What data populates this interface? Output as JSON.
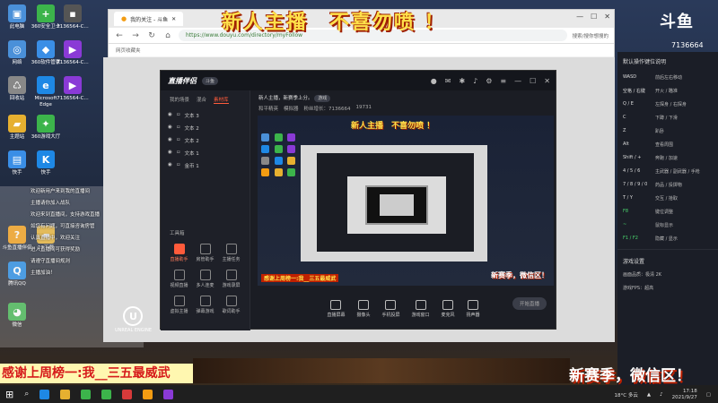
{
  "overlay": {
    "top_banner": "新人主播　不喜勿喷 ！",
    "bottom_left_banner": "感谢上周榜一:我__三五最威武",
    "bottom_right_banner": "新赛季，微信区！",
    "brand": "斗鱼",
    "room_id": "7136664"
  },
  "desktop_icons": [
    {
      "label": "此电脑",
      "icon": "computer-icon",
      "color": "#4a90d9"
    },
    {
      "label": "360安全卫士",
      "icon": "shield-icon",
      "color": "#3cb44b"
    },
    {
      "label": "7136564-C...",
      "icon": "file-icon",
      "color": "#666"
    },
    {
      "label": "网络",
      "icon": "network-icon",
      "color": "#4a90d9"
    },
    {
      "label": "360软件管家",
      "icon": "store-icon",
      "color": "#3a8ee6"
    },
    {
      "label": "7136564-C...",
      "icon": "video-icon",
      "color": "#8a3ad6"
    },
    {
      "label": "回收站",
      "icon": "trash-icon",
      "color": "#888"
    },
    {
      "label": "Microsoft Edge",
      "icon": "edge-icon",
      "color": "#1e88e5"
    },
    {
      "label": "7136564-C...",
      "icon": "video-icon",
      "color": "#8a3ad6"
    },
    {
      "label": "主题站",
      "icon": "folder-icon",
      "color": "#e6b030"
    },
    {
      "label": "360游戏大厅",
      "icon": "game-icon",
      "color": "#3cb44b"
    },
    {
      "label": "快手",
      "icon": "kuaishou-icon",
      "color": "#1e88e5"
    },
    {
      "label": "13下载",
      "icon": "download-icon",
      "color": "#d63a3a"
    },
    {
      "label": "斗鱼直播伴侣",
      "icon": "douyu-icon",
      "color": "#f39c12"
    },
    {
      "label": "腾讯QQ",
      "icon": "qq-icon",
      "color": "#1e88e5"
    },
    {
      "label": "微信",
      "icon": "wechat-icon",
      "color": "#3cb44b"
    }
  ],
  "browser": {
    "tab_title": "我的关注 - 斗鱼",
    "url": "https://www.douyu.com/directory/myFollow",
    "bookmarks": "网页收藏夹",
    "right_controls": "搜索/搜你想搜的"
  },
  "app": {
    "logo": "直播伴侣",
    "version_badge": "斗鱼",
    "left_tabs": [
      "我的场景",
      "混合",
      "素材库"
    ],
    "scenes": [
      "文本 3",
      "文本 2",
      "文本 2",
      "文本 1",
      "金币 1"
    ],
    "tools_title": "工具箱",
    "tools": [
      "直播助手",
      "房管助手",
      "主播任务",
      "视频直播",
      "多人连麦",
      "游戏录屏",
      "虚拟主播",
      "弹幕游戏",
      "歌词助手",
      "主播专区"
    ],
    "title_line": "新人主播，新赛季上分。",
    "title_tag": "游戏",
    "stream_info": [
      "和平精英",
      "模拟器",
      "粉丝增长：7136664",
      "19731"
    ],
    "bottom_tools": [
      "直播屏幕",
      "摄像头",
      "手机投屏",
      "游戏窗口",
      "麦克风",
      "扬声器"
    ],
    "start_button": "开始直播",
    "preview_top": "新人主播　不喜勿喷 ！",
    "preview_bottom_left": "感谢上周榜一:我__三五最威武",
    "preview_bottom_right": "新赛季，微信区！"
  },
  "help_panel": {
    "title": "默认操作键位说明",
    "rows": [
      {
        "key": "WASD",
        "desc": "前后左右移动"
      },
      {
        "key": "空格 / 右键",
        "desc": "开火 / 瞄准"
      },
      {
        "key": "Q / E",
        "desc": "左探身 / 右探身"
      },
      {
        "key": "C",
        "desc": "下蹲 / 下滑"
      },
      {
        "key": "Z",
        "desc": "趴卧"
      },
      {
        "key": "Alt",
        "desc": "查看周围"
      },
      {
        "key": "Shift / +",
        "desc": "奔跑 / 加速"
      },
      {
        "key": "4 / 5 / 6",
        "desc": "主武器 / 副武器 / 手枪"
      },
      {
        "key": "7 / 8 / 9 / 0",
        "desc": "药品 / 投掷物"
      },
      {
        "key": "T / Y",
        "desc": "交互 / 拾取"
      },
      {
        "key": "F8",
        "desc": "键位调整"
      },
      {
        "key": "~",
        "desc": "鼠标显示"
      },
      {
        "key": "F1 / F2",
        "desc": "隐藏 / 显示"
      }
    ],
    "settings_title": "游戏设置",
    "settings": [
      "画面品质：极清 2K",
      "游戏FPS：超高"
    ]
  },
  "chat_lines": [
    "欢迎新用户来到我的直播间",
    "主播请你加入战队",
    "欢迎来到直播间，支持游戏直播",
    "如您有问题，可直接咨询房管",
    "认真直播中，欢迎关注",
    "进入直播间可获得奖励",
    "请遵守直播间规则",
    "主播加油！"
  ],
  "unreal": "UNREAL ENGINE",
  "taskbar": {
    "weather": "18°C 多云",
    "time": "17:18",
    "date": "2021/9/27"
  }
}
